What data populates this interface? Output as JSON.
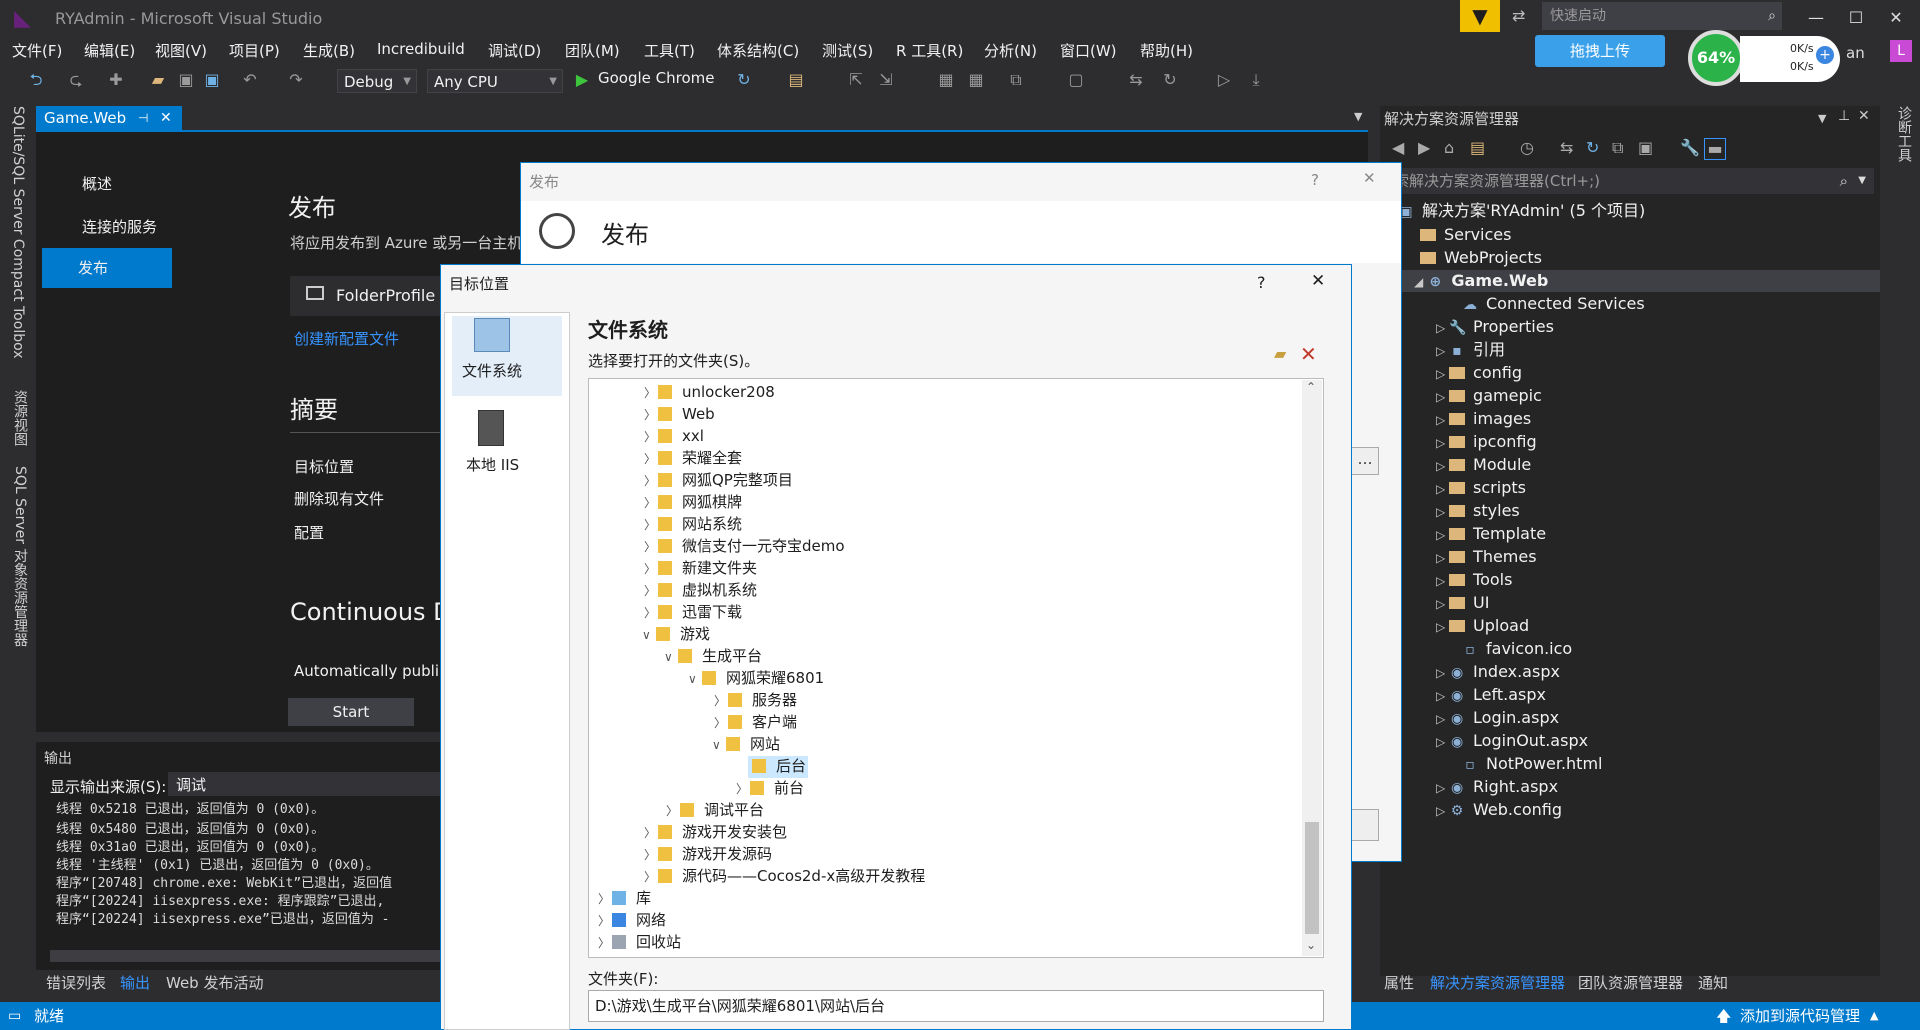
{
  "window": {
    "title": "RYAdmin - Microsoft Visual Studio",
    "quick_launch_placeholder": "快速启动",
    "user_initial": "L",
    "user_name_fragment": "an"
  },
  "menu": [
    "文件(F)",
    "编辑(E)",
    "视图(V)",
    "项目(P)",
    "生成(B)",
    "Incredibuild",
    "调试(D)",
    "团队(M)",
    "工具(T)",
    "体系结构(C)",
    "测试(S)",
    "R 工具(R)",
    "分析(N)",
    "窗口(W)",
    "帮助(H)"
  ],
  "toolbar": {
    "config": "Debug",
    "platform": "Any CPU",
    "run_target": "Google Chrome"
  },
  "widget": {
    "upload_label": "拖拽上传",
    "cpu_percent": "64%",
    "net_up": "0K/s",
    "net_down": "0K/s"
  },
  "left_strip": [
    "SQLite/SQL Server Compact Toolbox",
    "资源视图",
    "SQL Server 对象资源管理器"
  ],
  "right_strip": [
    "诊断工具"
  ],
  "doc_tab": "Game.Web",
  "publish_page": {
    "nav": [
      "概述",
      "连接的服务",
      "发布"
    ],
    "heading": "发布",
    "desc": "将应用发布到 Azure 或另一台主机",
    "profile": "FolderProfile",
    "create_profile": "创建新配置文件",
    "summary": "摘要",
    "summary_items": [
      "目标位置",
      "删除现有文件",
      "配置"
    ],
    "continuous": "Continuous D",
    "auto_text": "Automatically publi",
    "start_btn": "Start"
  },
  "output": {
    "title": "输出",
    "source_label": "显示输出来源(S):",
    "source_value": "调试",
    "lines": [
      "线程 0x5218 已退出，返回值为 0 (0x0)。",
      "线程 0x5480 已退出，返回值为 0 (0x0)。",
      "线程 0x31a0 已退出，返回值为 0 (0x0)。",
      "线程 '主线程' (0x1) 已退出，返回值为 0 (0x0)。",
      "程序“[20748] chrome.exe: WebKit”已退出，返回值",
      "程序“[20224] iisexpress.exe: 程序跟踪”已退出,",
      "程序“[20224] iisexpress.exe”已退出，返回值为 -"
    ]
  },
  "bottom_tabs": [
    "错误列表",
    "输出",
    "Web 发布活动"
  ],
  "status": {
    "left": "就绪",
    "right": "添加到源代码管理"
  },
  "solution": {
    "title": "解决方案资源管理器",
    "search_placeholder": "索解决方案资源管理器(Ctrl+;)",
    "items": [
      {
        "label": "解决方案'RYAdmin' (5 个项目)",
        "kind": "solution"
      },
      {
        "label": "Services",
        "kind": "folder"
      },
      {
        "label": "WebProjects",
        "kind": "folder"
      },
      {
        "label": "Game.Web",
        "kind": "project"
      },
      {
        "label": "Connected Services",
        "kind": "file"
      },
      {
        "label": "Properties",
        "kind": "file"
      },
      {
        "label": "引用",
        "kind": "file"
      },
      {
        "label": "config",
        "kind": "folder"
      },
      {
        "label": "gamepic",
        "kind": "folder"
      },
      {
        "label": "images",
        "kind": "folder"
      },
      {
        "label": "ipconfig",
        "kind": "folder"
      },
      {
        "label": "Module",
        "kind": "folder"
      },
      {
        "label": "scripts",
        "kind": "folder"
      },
      {
        "label": "styles",
        "kind": "folder"
      },
      {
        "label": "Template",
        "kind": "folder"
      },
      {
        "label": "Themes",
        "kind": "folder"
      },
      {
        "label": "Tools",
        "kind": "folder"
      },
      {
        "label": "UI",
        "kind": "folder"
      },
      {
        "label": "Upload",
        "kind": "folder"
      },
      {
        "label": "favicon.ico",
        "kind": "file"
      },
      {
        "label": "Index.aspx",
        "kind": "file"
      },
      {
        "label": "Left.aspx",
        "kind": "file"
      },
      {
        "label": "Login.aspx",
        "kind": "file"
      },
      {
        "label": "LoginOut.aspx",
        "kind": "file"
      },
      {
        "label": "NotPower.html",
        "kind": "file"
      },
      {
        "label": "Right.aspx",
        "kind": "file"
      },
      {
        "label": "Web.config",
        "kind": "file"
      }
    ],
    "bottom_tabs": [
      "属性",
      "解决方案资源管理器",
      "团队资源管理器",
      "通知"
    ]
  },
  "publish_dialog": {
    "caption": "发布",
    "title": "发布",
    "help": "?",
    "close": "✕"
  },
  "target_dialog": {
    "caption": "目标位置",
    "side": [
      "文件系统",
      "本地 IIS"
    ],
    "heading": "文件系统",
    "prompt": "选择要打开的文件夹(S)。",
    "tree": [
      {
        "label": "unlocker208"
      },
      {
        "label": "Web"
      },
      {
        "label": "xxl"
      },
      {
        "label": "荣耀全套"
      },
      {
        "label": "网狐QP完整项目"
      },
      {
        "label": "网狐棋牌"
      },
      {
        "label": "网站系统"
      },
      {
        "label": "微信支付一元夺宝demo"
      },
      {
        "label": "新建文件夹"
      },
      {
        "label": "虚拟机系统"
      },
      {
        "label": "迅雷下载"
      },
      {
        "label": "游戏"
      },
      {
        "label": "生成平台"
      },
      {
        "label": "网狐荣耀6801"
      },
      {
        "label": "服务器"
      },
      {
        "label": "客户端"
      },
      {
        "label": "网站"
      },
      {
        "label": "后台"
      },
      {
        "label": "前台"
      },
      {
        "label": "调试平台"
      },
      {
        "label": "游戏开发安装包"
      },
      {
        "label": "游戏开发源码"
      },
      {
        "label": "源代码——Cocos2d-x高级开发教程"
      },
      {
        "label": "库"
      },
      {
        "label": "网络"
      },
      {
        "label": "回收站"
      }
    ],
    "folder_label": "文件夹(F):",
    "folder_value": "D:\\游戏\\生成平台\\网狐荣耀6801\\网站\\后台"
  }
}
